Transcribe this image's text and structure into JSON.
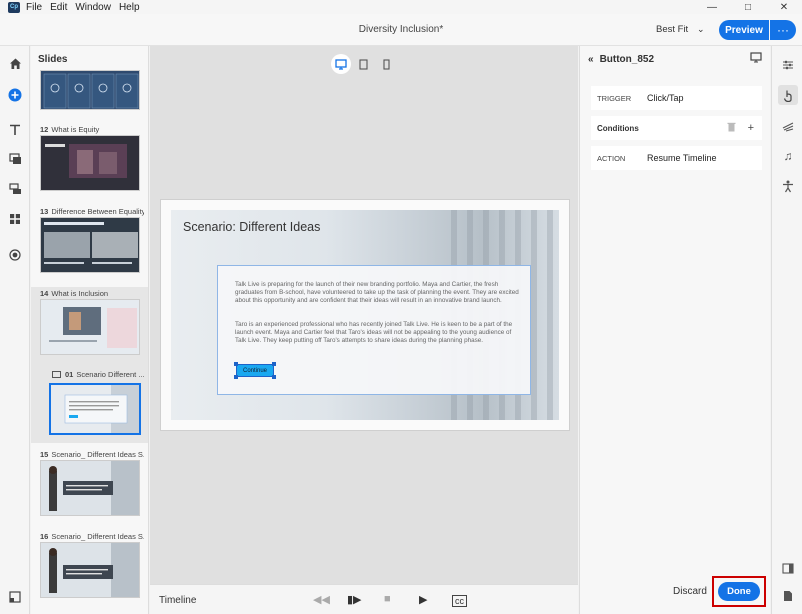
{
  "menubar": {
    "app_icon": "Cp",
    "items": [
      "File",
      "Edit",
      "Window",
      "Help"
    ]
  },
  "topbar": {
    "doc_title": "Diversity Inclusion*",
    "fit_value": "Best Fit",
    "preview_label": "Preview",
    "more_label": "···"
  },
  "slides": {
    "title": "Slides",
    "items": [
      {
        "number": "12",
        "title": "What is Equity"
      },
      {
        "number": "13",
        "title": "Difference Between Equality..."
      },
      {
        "number": "14",
        "title": "What is Inclusion"
      },
      {
        "number": "01",
        "title": "Scenario Different ..."
      },
      {
        "number": "15",
        "title": "Scenario_ Different Ideas S..."
      },
      {
        "number": "16",
        "title": "Scenario_ Different Ideas S..."
      }
    ]
  },
  "slide": {
    "heading": "Scenario: Different Ideas",
    "paragraph1": "Talk Live is preparing for the launch of their new branding portfolio. Maya and Cartier, the fresh graduates from B-school, have volunteered to take up the task of planning the event. They are excited about this opportunity and are confident that their ideas will result in an innovative brand launch.",
    "paragraph2": "Taro is an experienced professional who has recently joined Talk Live. He is keen to be a part of the launch event. Maya and Cartier feel that Taro's ideas will not be appealing to the young audience of Talk Live. They keep putting off Taro's attempts to share ideas during the planning phase.",
    "button_label": "Continue"
  },
  "timeline": {
    "label": "Timeline"
  },
  "props": {
    "object_name": "Button_852",
    "trigger_key": "TRIGGER",
    "trigger_value": "Click/Tap",
    "conditions_label": "Conditions",
    "action_key": "ACTION",
    "action_value": "Resume Timeline",
    "discard_label": "Discard",
    "done_label": "Done"
  },
  "colors": {
    "accent": "#1473e6",
    "highlight_outline": "#cc0000",
    "selection": "#1e63c8",
    "button_fill": "#1aa8f0"
  }
}
